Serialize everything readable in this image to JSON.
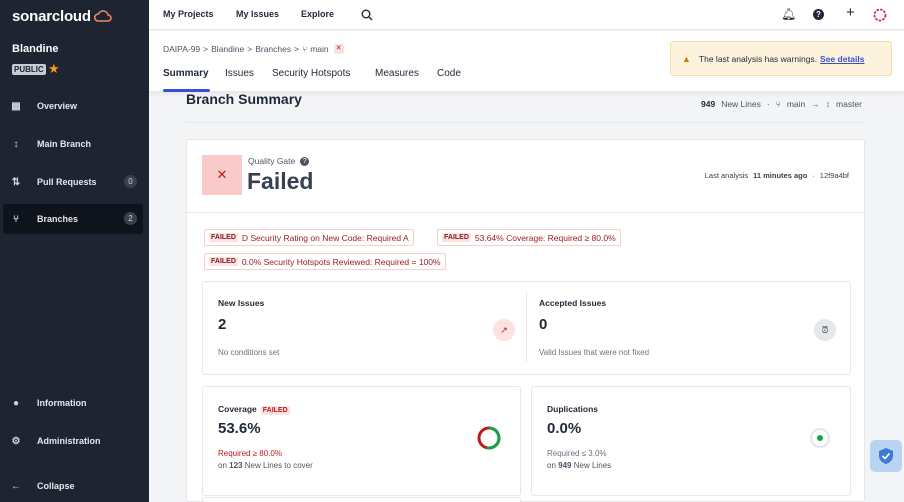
{
  "sidebar": {
    "logo_text_light": "sonar",
    "logo_text_bold": "cloud",
    "project_name": "Blandine",
    "visibility": "PUBLIC",
    "items": [
      {
        "label": "Overview",
        "icon": "overview-icon"
      },
      {
        "label": "Main Branch",
        "icon": "main-branch-icon"
      },
      {
        "label": "Pull Requests",
        "icon": "pull-requests-icon",
        "badge": "0"
      },
      {
        "label": "Branches",
        "icon": "branches-icon",
        "badge": "2",
        "active": true
      },
      {
        "label": "Information",
        "icon": "info-icon"
      },
      {
        "label": "Administration",
        "icon": "gear-icon"
      },
      {
        "label": "Collapse",
        "icon": "arrow-left-icon"
      }
    ]
  },
  "topbar": {
    "links": [
      "My Projects",
      "My Issues",
      "Explore"
    ]
  },
  "subheader": {
    "breadcrumb": [
      "DAIPA-99",
      "Blandine",
      "Branches",
      "main"
    ],
    "tabs": [
      "Summary",
      "Issues",
      "Security Hotspots",
      "Measures",
      "Code"
    ],
    "warning_text": "The last analysis has warnings.",
    "warning_link": "See details"
  },
  "summary": {
    "title": "Branch Summary",
    "new_lines_count": "949",
    "new_lines_label": "New Lines",
    "branch": "main",
    "target_branch": "master"
  },
  "quality_gate": {
    "label": "Quality Gate",
    "status": "Failed",
    "last_analysis_label": "Last analysis",
    "last_analysis_time": "11 minutes ago",
    "commit": "12f9a4bf",
    "conditions": [
      {
        "tag": "FAILED",
        "text": "D Security Rating on New Code: Required A"
      },
      {
        "tag": "FAILED",
        "text": "53.64% Coverage: Required ≥ 80.0%"
      },
      {
        "tag": "FAILED",
        "text": "0.0% Security Hotspots Reviewed: Required = 100%"
      }
    ]
  },
  "metrics": {
    "new_issues": {
      "label": "New Issues",
      "value": "2",
      "sub": "No conditions set"
    },
    "accepted_issues": {
      "label": "Accepted Issues",
      "value": "0",
      "sub": "Valid Issues that were not fixed"
    },
    "coverage": {
      "label": "Coverage",
      "tag": "FAILED",
      "value": "53.6%",
      "required": "Required ≥ 80.0%",
      "on_prefix": "on",
      "on_count": "123",
      "on_suffix": "New Lines to cover",
      "percent": 53.6
    },
    "duplications": {
      "label": "Duplications",
      "value": "0.0%",
      "required": "Required ≤ 3.0%",
      "on_prefix": "on",
      "on_count": "949",
      "on_suffix": "New Lines",
      "percent": 0.0
    }
  },
  "colors": {
    "accent": "#3a4fcf",
    "fail": "#b91c1c",
    "pass": "#16a34a",
    "sidebar": "#1e2432"
  }
}
